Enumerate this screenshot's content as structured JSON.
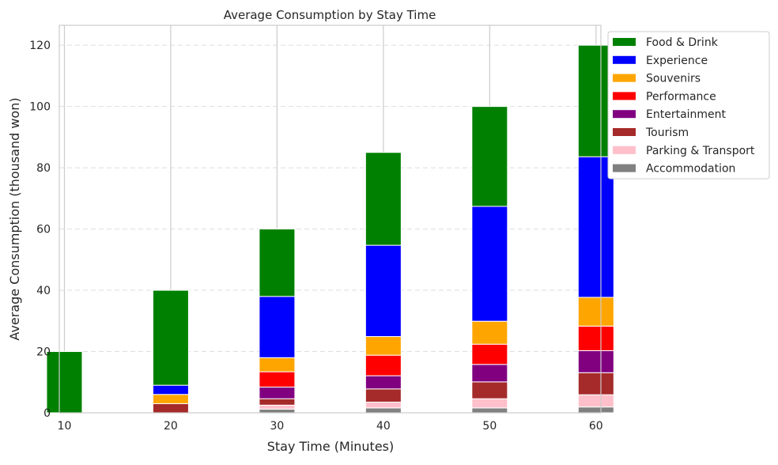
{
  "chart_data": {
    "type": "bar",
    "stacked": true,
    "title": "Average Consumption by Stay Time",
    "xlabel": "Stay Time (Minutes)",
    "ylabel": "Average Consumption (thousand won)",
    "categories": [
      "10",
      "20",
      "30",
      "40",
      "50",
      "60"
    ],
    "ylim": [
      0,
      126.5
    ],
    "yticks": [
      0,
      20,
      40,
      60,
      80,
      100,
      120
    ],
    "grid": {
      "x": "solid",
      "y": "dashed"
    },
    "legend_placement": "outside-top-right",
    "series": [
      {
        "name": "Accommodation",
        "color": "#808080",
        "values": [
          0,
          0,
          1.2,
          1.6,
          1.6,
          1.9
        ]
      },
      {
        "name": "Parking & Transport",
        "color": "#ffc0cb",
        "values": [
          0,
          0,
          1.3,
          1.9,
          3.0,
          4.0
        ]
      },
      {
        "name": "Tourism",
        "color": "#a52a2a",
        "values": [
          0,
          3.0,
          2.1,
          4.3,
          5.5,
          7.2
        ]
      },
      {
        "name": "Entertainment",
        "color": "#800080",
        "values": [
          0,
          0,
          3.8,
          4.3,
          5.7,
          7.2
        ]
      },
      {
        "name": "Performance",
        "color": "#ff0000",
        "values": [
          0,
          0,
          5.0,
          6.7,
          6.6,
          8.0
        ]
      },
      {
        "name": "Souvenirs",
        "color": "#ffa500",
        "values": [
          0,
          3.0,
          4.6,
          6.1,
          7.5,
          9.4
        ]
      },
      {
        "name": "Experience",
        "color": "#0000ff",
        "values": [
          0,
          3.0,
          20.0,
          29.8,
          37.5,
          45.9
        ]
      },
      {
        "name": "Food & Drink",
        "color": "#008000",
        "values": [
          20.0,
          31.0,
          22.0,
          30.3,
          32.6,
          36.4
        ]
      }
    ]
  }
}
